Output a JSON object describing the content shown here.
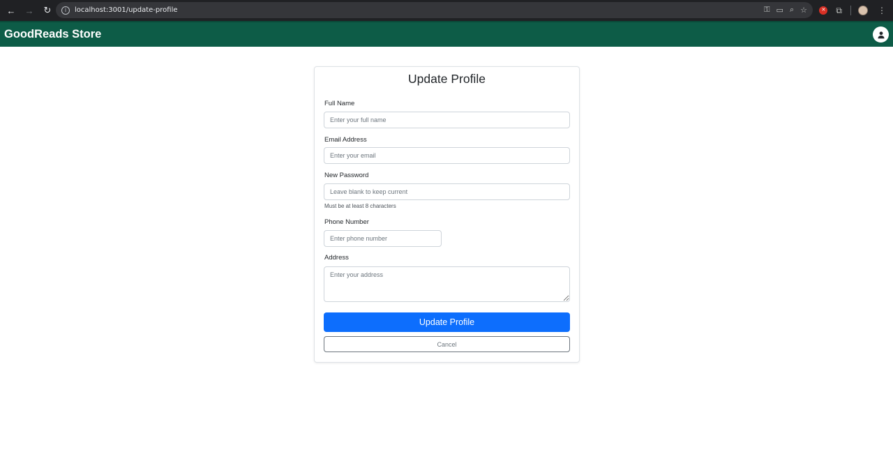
{
  "browser": {
    "url": "localhost:3001/update-profile",
    "icons": [
      "back-arrow-icon",
      "forward-arrow-icon",
      "reload-icon",
      "site-info-icon",
      "password-key-icon",
      "cast-icon",
      "zoom-icon",
      "bookmark-star-icon",
      "extension-icon",
      "extensions-puzzle-icon",
      "profile-avatar-icon",
      "menu-kebab-icon"
    ]
  },
  "navbar": {
    "brand": "GoodReads Store",
    "background": "#0d5c47",
    "user_icon": "user-icon"
  },
  "form": {
    "title": "Update Profile",
    "full_name": {
      "label": "Full Name",
      "placeholder": "Enter your full name",
      "value": ""
    },
    "email": {
      "label": "Email Address",
      "placeholder": "Enter your email",
      "value": ""
    },
    "password": {
      "label": "New Password",
      "placeholder": "Leave blank to keep current",
      "value": "",
      "hint": "Must be at least 8 characters"
    },
    "phone": {
      "label": "Phone Number",
      "placeholder": "Enter phone number",
      "value": ""
    },
    "address": {
      "label": "Address",
      "placeholder": "Enter your address",
      "value": ""
    },
    "submit_label": "Update Profile",
    "cancel_label": "Cancel",
    "primary_color": "#0d6efd"
  }
}
